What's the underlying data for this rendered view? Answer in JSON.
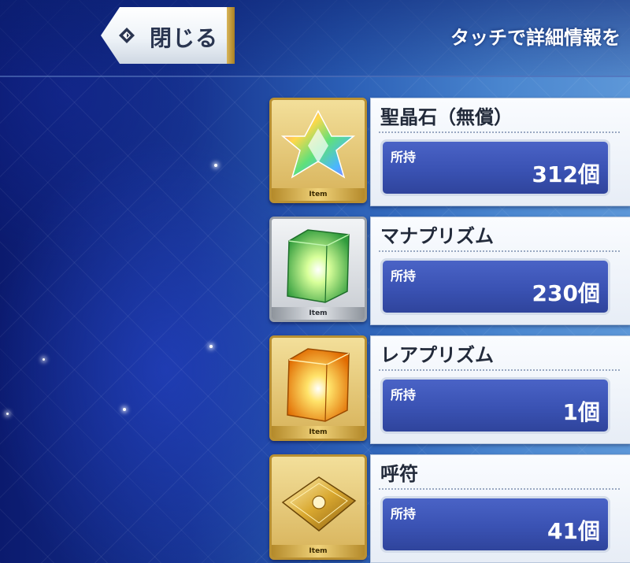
{
  "header": {
    "close_label": "閉じる",
    "hint": "タッチで詳細情報を"
  },
  "items": [
    {
      "name": "聖晶石（無償）",
      "count_label": "所持",
      "count": "312個",
      "tag": "Item",
      "icon": "saint-quartz-icon"
    },
    {
      "name": "マナプリズム",
      "count_label": "所持",
      "count": "230個",
      "tag": "Item",
      "icon": "mana-prism-icon"
    },
    {
      "name": "レアプリズム",
      "count_label": "所持",
      "count": "1個",
      "tag": "Item",
      "icon": "rare-prism-icon"
    },
    {
      "name": "呼符",
      "count_label": "所持",
      "count": "41個",
      "tag": "Item",
      "icon": "summon-ticket-icon"
    }
  ]
}
